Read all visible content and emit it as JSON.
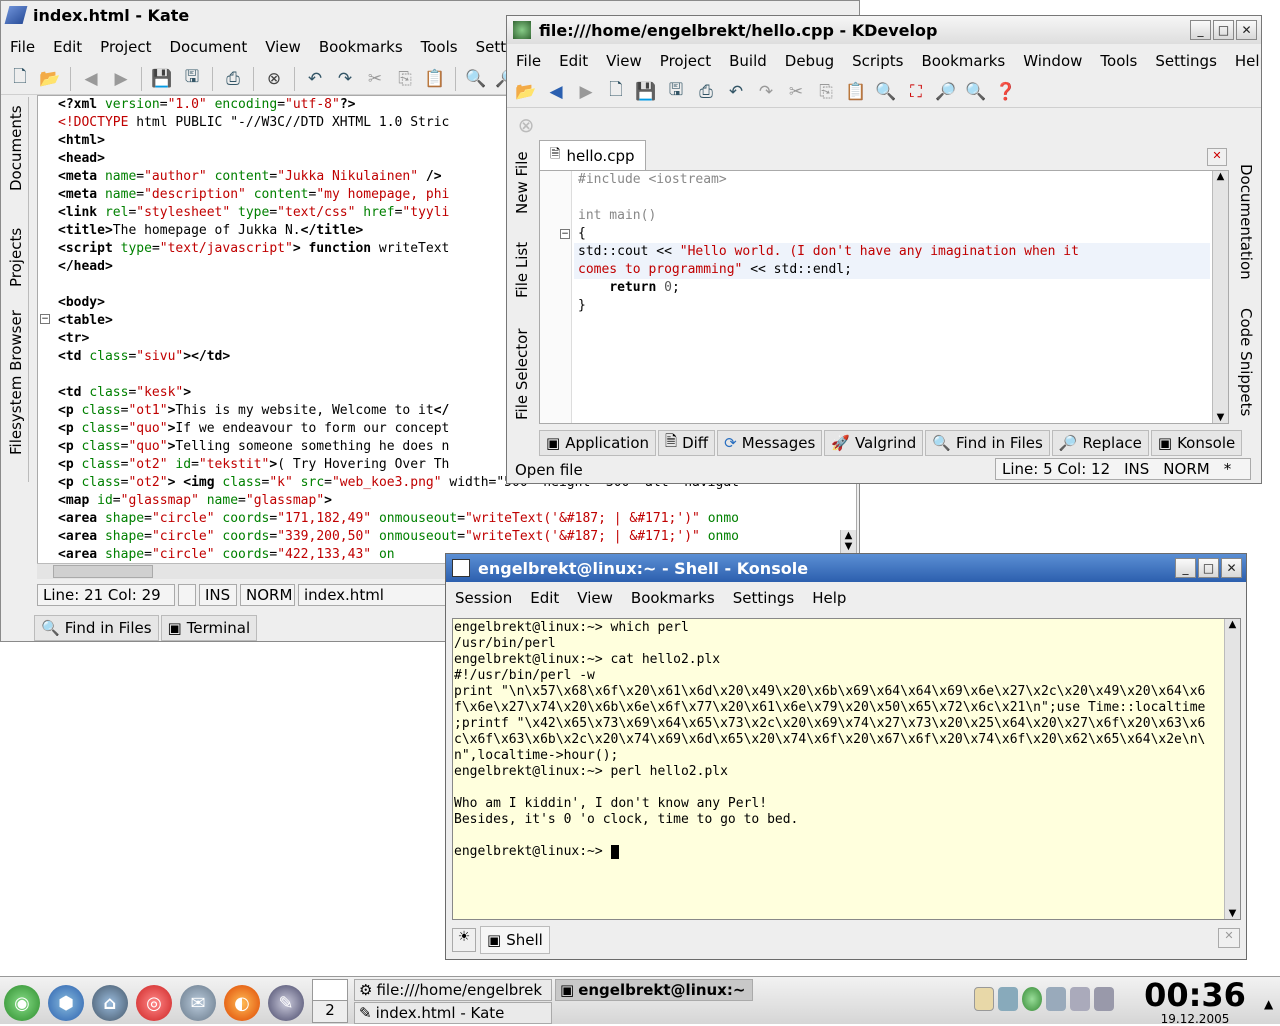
{
  "kate": {
    "title": "index.html - Kate",
    "menu": [
      "File",
      "Edit",
      "Project",
      "Document",
      "View",
      "Bookmarks",
      "Tools",
      "Setti"
    ],
    "side_tabs": [
      "Documents",
      "Projects",
      "Filesystem Browser"
    ],
    "code": [
      [
        [
          "t",
          "<?xml "
        ],
        [
          "a",
          "version"
        ],
        [
          "p",
          "="
        ],
        [
          "s",
          "\"1.0\""
        ],
        [
          "p",
          " "
        ],
        [
          "a",
          "encoding"
        ],
        [
          "p",
          "="
        ],
        [
          "s",
          "\"utf-8\""
        ],
        [
          "t",
          "?>"
        ]
      ],
      [
        [
          "s",
          "<!DOCTYPE"
        ],
        [
          "p",
          " html PUBLIC \"-//W3C//DTD XHTML 1.0 Stric"
        ]
      ],
      [
        [
          "t",
          "<html>"
        ]
      ],
      [
        [
          "t",
          "<head>"
        ]
      ],
      [
        [
          "t",
          "<meta "
        ],
        [
          "a",
          "name"
        ],
        [
          "p",
          "="
        ],
        [
          "s",
          "\"author\""
        ],
        [
          "p",
          " "
        ],
        [
          "a",
          "content"
        ],
        [
          "p",
          "="
        ],
        [
          "s",
          "\"Jukka Nikulainen\""
        ],
        [
          "t",
          " />"
        ]
      ],
      [
        [
          "t",
          "<meta "
        ],
        [
          "a",
          "name"
        ],
        [
          "p",
          "="
        ],
        [
          "s",
          "\"description\""
        ],
        [
          "p",
          " "
        ],
        [
          "a",
          "content"
        ],
        [
          "p",
          "="
        ],
        [
          "s",
          "\"my homepage, phi"
        ]
      ],
      [
        [
          "t",
          "<link "
        ],
        [
          "a",
          "rel"
        ],
        [
          "p",
          "="
        ],
        [
          "s",
          "\"stylesheet\""
        ],
        [
          "p",
          " "
        ],
        [
          "a",
          "type"
        ],
        [
          "p",
          "="
        ],
        [
          "s",
          "\"text/css\""
        ],
        [
          "p",
          " "
        ],
        [
          "a",
          "href"
        ],
        [
          "p",
          "="
        ],
        [
          "s",
          "\"tyyli"
        ]
      ],
      [
        [
          "t",
          "<title>"
        ],
        [
          "p",
          "The homepage of Jukka N."
        ],
        [
          "t",
          "</title>"
        ]
      ],
      [
        [
          "t",
          "<script "
        ],
        [
          "a",
          "type"
        ],
        [
          "p",
          "="
        ],
        [
          "s",
          "\"text/javascript\""
        ],
        [
          "t",
          "> function "
        ],
        [
          "p",
          "writeText"
        ]
      ],
      [
        [
          "t",
          "</head>"
        ]
      ],
      [
        [
          "p",
          ""
        ]
      ],
      [
        [
          "t",
          "<body>"
        ]
      ],
      [
        [
          "t",
          "<table>"
        ]
      ],
      [
        [
          "t",
          "<tr>"
        ]
      ],
      [
        [
          "t",
          "<td "
        ],
        [
          "a",
          "class"
        ],
        [
          "p",
          "="
        ],
        [
          "s",
          "\"sivu\""
        ],
        [
          "t",
          "></td>"
        ]
      ],
      [
        [
          "p",
          ""
        ]
      ],
      [
        [
          "t",
          "<td "
        ],
        [
          "a",
          "class"
        ],
        [
          "p",
          "="
        ],
        [
          "s",
          "\"kesk\""
        ],
        [
          "t",
          ">"
        ]
      ],
      [
        [
          "t",
          "<p "
        ],
        [
          "a",
          "class"
        ],
        [
          "p",
          "="
        ],
        [
          "s",
          "\"ot1\""
        ],
        [
          "t",
          ">"
        ],
        [
          "p",
          "This is my website, Welcome to it"
        ],
        [
          "t",
          "</"
        ]
      ],
      [
        [
          "t",
          "<p "
        ],
        [
          "a",
          "class"
        ],
        [
          "p",
          "="
        ],
        [
          "s",
          "\"quo\""
        ],
        [
          "t",
          ">"
        ],
        [
          "p",
          "If we endeavour to form our concept"
        ]
      ],
      [
        [
          "t",
          "<p "
        ],
        [
          "a",
          "class"
        ],
        [
          "p",
          "="
        ],
        [
          "s",
          "\"quo\""
        ],
        [
          "t",
          ">"
        ],
        [
          "p",
          "Telling someone something he does n"
        ]
      ],
      [
        [
          "t",
          "<p "
        ],
        [
          "a",
          "class"
        ],
        [
          "p",
          "="
        ],
        [
          "s",
          "\"ot2\""
        ],
        [
          "p",
          " "
        ],
        [
          "a",
          "id"
        ],
        [
          "p",
          "="
        ],
        [
          "s",
          "\"tekstit\""
        ],
        [
          "t",
          ">"
        ],
        [
          "p",
          "( Try Hovering Over Th"
        ]
      ],
      [
        [
          "t",
          "<p "
        ],
        [
          "a",
          "class"
        ],
        [
          "p",
          "="
        ],
        [
          "s",
          "\"ot2\""
        ],
        [
          "t",
          "> <img "
        ],
        [
          "a",
          "class"
        ],
        [
          "p",
          "="
        ],
        [
          "s",
          "\"k\""
        ],
        [
          "p",
          " "
        ],
        [
          "a",
          "src"
        ],
        [
          "p",
          "="
        ],
        [
          "s",
          "\"web_koe3.png\""
        ],
        [
          "p",
          " width=\"500\" height=\"300\" alt=\"navigat"
        ]
      ],
      [
        [
          "t",
          "<map "
        ],
        [
          "a",
          "id"
        ],
        [
          "p",
          "="
        ],
        [
          "s",
          "\"glassmap\""
        ],
        [
          "p",
          " "
        ],
        [
          "a",
          "name"
        ],
        [
          "p",
          "="
        ],
        [
          "s",
          "\"glassmap\""
        ],
        [
          "t",
          ">"
        ]
      ],
      [
        [
          "t",
          "<area "
        ],
        [
          "a",
          "shape"
        ],
        [
          "p",
          "="
        ],
        [
          "s",
          "\"circle\""
        ],
        [
          "p",
          " "
        ],
        [
          "a",
          "coords"
        ],
        [
          "p",
          "="
        ],
        [
          "s",
          "\"171,182,49\""
        ],
        [
          "p",
          " "
        ],
        [
          "a",
          "onmouseout"
        ],
        [
          "p",
          "="
        ],
        [
          "s",
          "\"writeText('&#187; | &#171;')\""
        ],
        [
          "p",
          " "
        ],
        [
          "a",
          "onmo"
        ]
      ],
      [
        [
          "t",
          "<area "
        ],
        [
          "a",
          "shape"
        ],
        [
          "p",
          "="
        ],
        [
          "s",
          "\"circle\""
        ],
        [
          "p",
          " "
        ],
        [
          "a",
          "coords"
        ],
        [
          "p",
          "="
        ],
        [
          "s",
          "\"339,200,50\""
        ],
        [
          "p",
          " "
        ],
        [
          "a",
          "onmouseout"
        ],
        [
          "p",
          "="
        ],
        [
          "s",
          "\"writeText('&#187; | &#171;')\""
        ],
        [
          "p",
          " "
        ],
        [
          "a",
          "onmo"
        ]
      ],
      [
        [
          "t",
          "<area "
        ],
        [
          "a",
          "shape"
        ],
        [
          "p",
          "="
        ],
        [
          "s",
          "\"circle\""
        ],
        [
          "p",
          " "
        ],
        [
          "a",
          "coords"
        ],
        [
          "p",
          "="
        ],
        [
          "s",
          "\"422,133,43\""
        ],
        [
          "p",
          " "
        ],
        [
          "a",
          "on"
        ]
      ]
    ],
    "status": {
      "line_col": "Line: 21 Col: 29",
      "ins": "INS",
      "norm": "NORM",
      "file": "index.html"
    },
    "bottom_tabs": [
      "Find in Files",
      "Terminal"
    ]
  },
  "kdevelop": {
    "title": "file:///home/engelbrekt/hello.cpp - KDevelop",
    "menu": [
      "File",
      "Edit",
      "View",
      "Project",
      "Build",
      "Debug",
      "Scripts",
      "Bookmarks",
      "Window",
      "Tools",
      "Settings",
      "Help"
    ],
    "tab": "hello.cpp",
    "left_tabs": [
      "New File",
      "File List",
      "File Selector"
    ],
    "right_tabs": [
      "Documentation",
      "Code Snippets"
    ],
    "code": [
      [
        [
          "c",
          "#include <iostream>"
        ]
      ],
      [
        [
          "p",
          ""
        ]
      ],
      [
        [
          "c",
          "int main()"
        ]
      ],
      [
        [
          "p",
          "{"
        ]
      ],
      [
        [
          "p",
          "std::cout <"
        ],
        [
          "p",
          "< "
        ],
        [
          "s",
          "\"Hello world. (I don't have any imagination when it"
        ]
      ],
      [
        [
          "s",
          "comes to programming\""
        ],
        [
          "p",
          " << std::endl;"
        ]
      ],
      [
        [
          "p",
          "    "
        ],
        [
          "k",
          "return"
        ],
        [
          "p",
          " "
        ],
        [
          "n",
          "0"
        ],
        [
          "p",
          ";"
        ]
      ],
      [
        [
          "p",
          "}"
        ]
      ]
    ],
    "bottom_tabs": [
      "Application",
      "Diff",
      "Messages",
      "Valgrind",
      "Find in Files",
      "Replace",
      "Konsole"
    ],
    "status_left": "Open file",
    "status": {
      "line_col": "Line: 5 Col: 12",
      "ins": "INS",
      "norm": "NORM",
      "mod": "*"
    }
  },
  "konsole": {
    "title": "engelbrekt@linux:~ - Shell - Konsole",
    "menu": [
      "Session",
      "Edit",
      "View",
      "Bookmarks",
      "Settings",
      "Help"
    ],
    "lines": [
      "engelbrekt@linux:~> which perl",
      "/usr/bin/perl",
      "engelbrekt@linux:~> cat hello2.plx",
      "#!/usr/bin/perl -w",
      "print \"\\n\\x57\\x68\\x6f\\x20\\x61\\x6d\\x20\\x49\\x20\\x6b\\x69\\x64\\x64\\x69\\x6e\\x27\\x2c\\x20\\x49\\x20\\x64\\x6",
      "f\\x6e\\x27\\x74\\x20\\x6b\\x6e\\x6f\\x77\\x20\\x61\\x6e\\x79\\x20\\x50\\x65\\x72\\x6c\\x21\\n\";use Time::localtime",
      ";printf \"\\x42\\x65\\x73\\x69\\x64\\x65\\x73\\x2c\\x20\\x69\\x74\\x27\\x73\\x20\\x25\\x64\\x20\\x27\\x6f\\x20\\x63\\x6",
      "c\\x6f\\x63\\x6b\\x2c\\x20\\x74\\x69\\x6d\\x65\\x20\\x74\\x6f\\x20\\x67\\x6f\\x20\\x74\\x6f\\x20\\x62\\x65\\x64\\x2e\\n\\",
      "n\",localtime->hour();",
      "engelbrekt@linux:~> perl hello2.plx",
      "",
      "Who am I kiddin', I don't know any Perl!",
      "Besides, it's 0 'o clock, time to go to bed.",
      "",
      "engelbrekt@linux:~> "
    ],
    "tab": "Shell"
  },
  "taskbar": {
    "desktop_num": "2",
    "tasks": [
      "file:///home/engelbrek",
      "engelbrekt@linux:~",
      "index.html - Kate"
    ],
    "time": "00:36",
    "date": "19.12.2005"
  },
  "colors": {
    "terminal_bg": "#ffffdd",
    "kde_accent": "#3a6fb0"
  }
}
